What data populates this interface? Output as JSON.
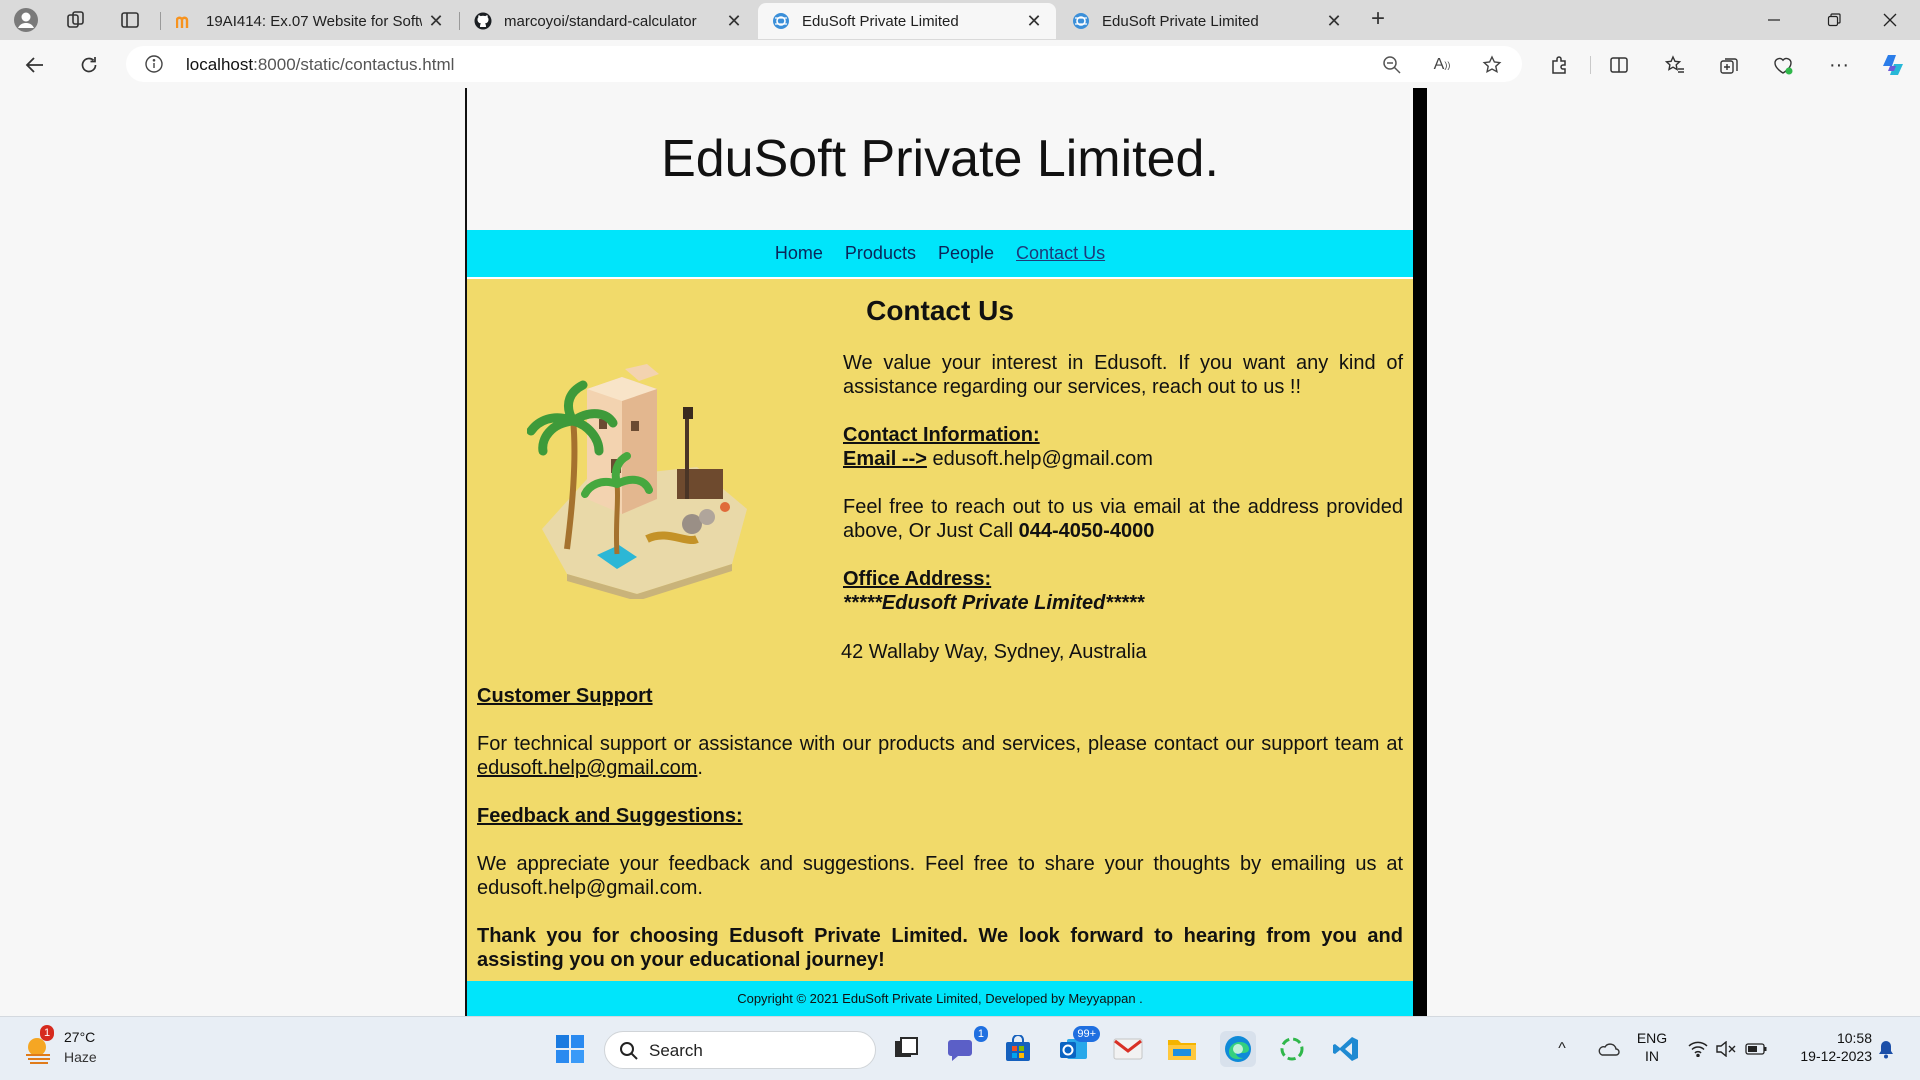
{
  "browser": {
    "tabs": [
      {
        "title": "19AI414: Ex.07 Website for Softw",
        "icon": "moodle-icon",
        "active": false
      },
      {
        "title": "marcoyoi/standard-calculator",
        "icon": "github-icon",
        "active": false
      },
      {
        "title": "EduSoft Private Limited",
        "icon": "globe-icon",
        "active": true
      },
      {
        "title": "EduSoft Private Limited",
        "icon": "globe-icon",
        "active": false
      }
    ],
    "url_host": "localhost",
    "url_path": ":8000/static/contactus.html"
  },
  "page": {
    "site_title": "EduSoft Private Limited.",
    "nav": [
      "Home",
      "Products",
      "People",
      "Contact Us"
    ],
    "heading": "Contact Us",
    "intro": "We value your interest in Edusoft. If you want any kind of assistance regarding our services, reach out to us !!",
    "contact_info_label": "Contact Information:",
    "email_label": "Email -->",
    "email": "edusoft.help@gmail.com",
    "call_text": "Feel free to reach out to us via email at the address provided above, Or Just Call",
    "phone": "044-4050-4000",
    "office_label": "Office Address:",
    "company_name": "*****Edusoft Private Limited*****",
    "address": "42 Wallaby Way, Sydney, Australia",
    "support_heading": "Customer Support",
    "support_text": "For technical support or assistance with our products and services, please contact our support team at",
    "support_email": "edusoft.help@gmail.com",
    "support_end": ".",
    "feedback_heading": "Feedback and Suggestions:",
    "feedback_text": "We appreciate your feedback and suggestions. Feel free to share your thoughts by emailing us at edusoft.help@gmail.com.",
    "thanks": "Thank you for choosing Edusoft Private Limited. We look forward to hearing from you and assisting you on your educational journey!",
    "footer": "Copyright © 2021 EduSoft Private Limited, Developed by Meyyappan ."
  },
  "taskbar": {
    "weather_temp": "27°C",
    "weather_cond": "Haze",
    "weather_badge": "1",
    "search_label": "Search",
    "teams_badge": "1",
    "mail_badge": "99+",
    "lang": "ENG",
    "region": "IN",
    "time": "10:58",
    "date": "19-12-2023"
  },
  "colors": {
    "nav_bg": "#00e5fb",
    "content_bg": "#f1da6a"
  }
}
